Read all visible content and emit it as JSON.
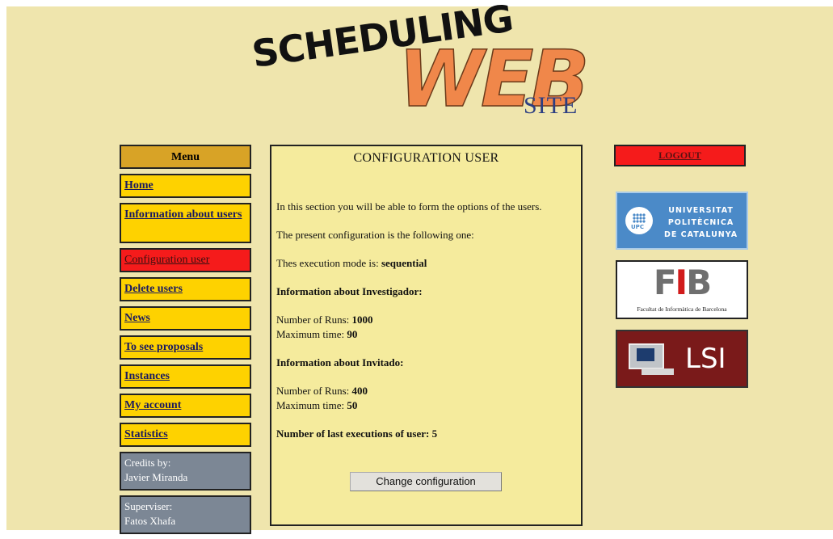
{
  "logo": {
    "word1": "SCHEDULING",
    "word2": "WEB",
    "word3": "SITE"
  },
  "menu": {
    "header": "Menu",
    "items": [
      {
        "label": "Home",
        "active": false
      },
      {
        "label": "Information about users",
        "active": false
      },
      {
        "label": "Configuration user",
        "active": true
      },
      {
        "label": "Delete users",
        "active": false
      },
      {
        "label": "News",
        "active": false
      },
      {
        "label": "To see proposals",
        "active": false
      },
      {
        "label": "Instances",
        "active": false
      },
      {
        "label": "My account",
        "active": false
      },
      {
        "label": "Statistics",
        "active": false
      }
    ],
    "credits": {
      "label": "Credits by:",
      "name": "Javier Miranda"
    },
    "supervisor": {
      "label": "Superviser:",
      "name": "Fatos Xhafa"
    }
  },
  "main": {
    "title": "CONFIGURATION USER",
    "intro": "In this section you will be able to form the options of the users.",
    "present": "The present configuration is the following one:",
    "mode_label": "Thes execution mode is: ",
    "mode_value": "sequential",
    "investigador": {
      "heading": "Information about Investigador:",
      "runs_label": "Number of Runs: ",
      "runs_value": "1000",
      "time_label": "Maximum time: ",
      "time_value": "90"
    },
    "invitado": {
      "heading": "Information about Invitado:",
      "runs_label": "Number of Runs: ",
      "runs_value": "400",
      "time_label": "Maximum time: ",
      "time_value": "50"
    },
    "last_exec_label": "Number of last executions of user: ",
    "last_exec_value": "5",
    "button": "Change configuration"
  },
  "logout": "LOGOUT",
  "partners": {
    "upc": {
      "line1": "UNIVERSITAT",
      "line2": "POLITÈCNICA",
      "line3": "DE CATALUNYA",
      "abbr": "UPC"
    },
    "fib": {
      "f": "F",
      "i": "I",
      "b": "B",
      "caption": "Facultat de Informàtica de Barcelona"
    },
    "lsi": {
      "label": "LSI"
    }
  },
  "colors": {
    "page_bg": "#efe5ad",
    "menu_item": "#fed200",
    "menu_active": "#f51b1b",
    "menu_header": "#d8a326",
    "credit_bg": "#7c8795",
    "panel_bg": "#f5eb9d",
    "logout_bg": "#f51b1b"
  }
}
